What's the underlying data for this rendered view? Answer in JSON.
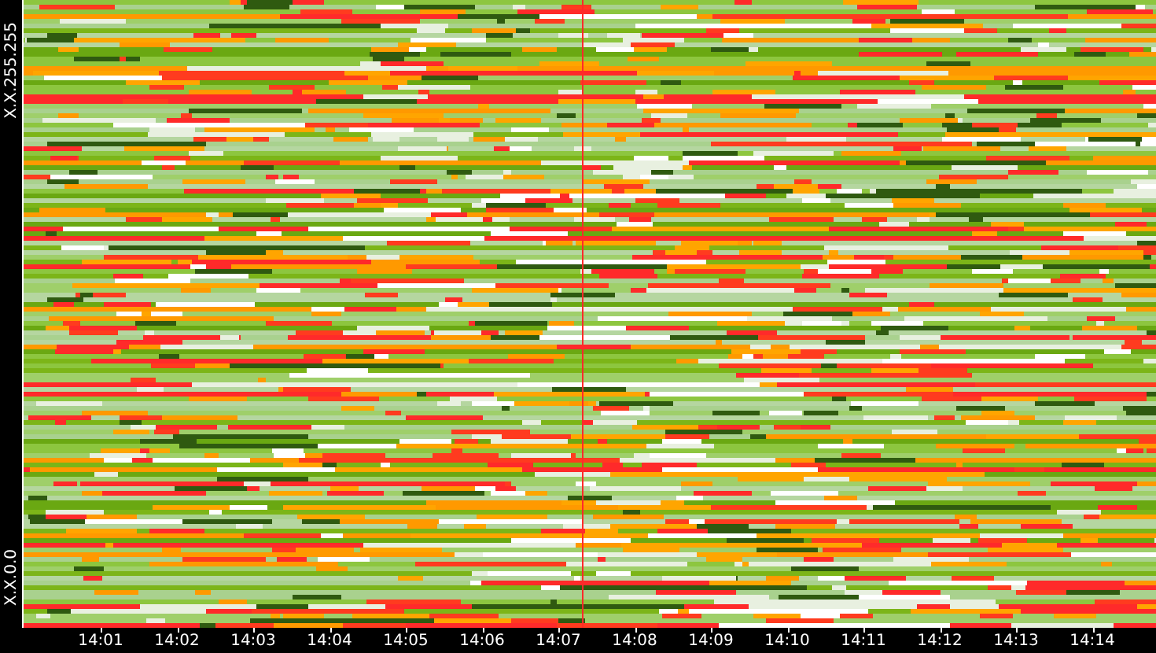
{
  "heatmap": {
    "y_labels": [
      "X.X.255.255",
      "X.X.0.0"
    ],
    "x_ticks": [
      "14:01",
      "14:02",
      "14:03",
      "14:04",
      "14:05",
      "14:06",
      "14:07",
      "14:08",
      "14:09",
      "14:10",
      "14:11",
      "14:12",
      "14:13",
      "14:14"
    ]
  }
}
